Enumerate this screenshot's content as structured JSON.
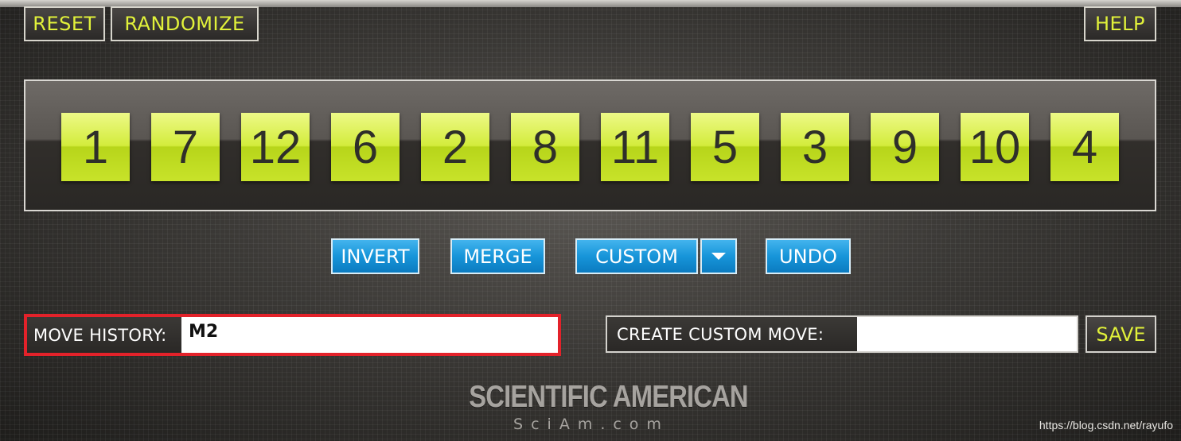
{
  "toolbar": {
    "reset_label": "RESET",
    "randomize_label": "RANDOMIZE",
    "help_label": "HELP"
  },
  "tiles": [
    "1",
    "7",
    "12",
    "6",
    "2",
    "8",
    "11",
    "5",
    "3",
    "9",
    "10",
    "4"
  ],
  "actions": {
    "invert_label": "INVERT",
    "merge_label": "MERGE",
    "custom_label": "CUSTOM",
    "undo_label": "UNDO"
  },
  "move_history": {
    "label": "MOVE HISTORY:",
    "value": "M2"
  },
  "custom_move": {
    "label": "CREATE CUSTOM MOVE:",
    "value": "",
    "save_label": "SAVE"
  },
  "branding": {
    "title": "SCIENTIFIC AMERICAN",
    "subtitle": "SciAm.com",
    "watermark": "https://blog.csdn.net/rayufo"
  },
  "colors": {
    "accent_yellow": "#e1f13a",
    "tile_green": "#d3ec3c",
    "button_blue": "#1795d9",
    "highlight_red": "#e3222a"
  },
  "icons": {
    "custom_dropdown": "chevron-down-icon"
  }
}
